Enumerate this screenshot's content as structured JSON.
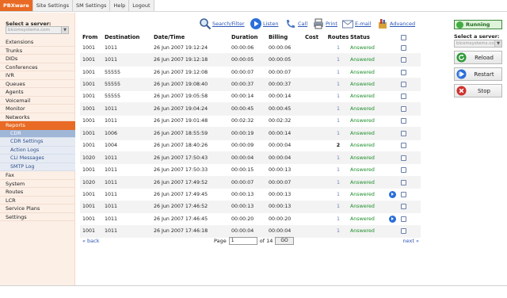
{
  "topnav": {
    "tabs": [
      "PBXware",
      "Site Settings",
      "SM Settings",
      "Help",
      "Logout"
    ]
  },
  "sidebar": {
    "select_label": "Select a server:",
    "select_value": "bicomsystems.com",
    "items": [
      "Extensions",
      "Trunks",
      "DIDs",
      "Conferences",
      "IVR",
      "Queues",
      "Agents",
      "Voicemail",
      "Monitor",
      "Networks",
      "Reports"
    ],
    "sub_items": [
      "CDR",
      "CDR Settings",
      "Action Logs",
      "CLI Messages",
      "SMTP Log"
    ],
    "items_after": [
      "Fax",
      "System",
      "Routes",
      "LCR",
      "Service Plans",
      "Settings"
    ]
  },
  "toolbar": {
    "search_filter": "Search/Filter",
    "listen": "Listen",
    "call": "Call",
    "print": "Print",
    "email": "E-mail",
    "advanced": "Advanced"
  },
  "table": {
    "headers": {
      "from": "From",
      "destination": "Destination",
      "datetime": "Date/Time",
      "duration": "Duration",
      "billing": "Billing",
      "cost": "Cost",
      "routes": "Routes",
      "status": "Status"
    },
    "rows": [
      {
        "from": "1001",
        "destination": "1011",
        "datetime": "26 Jun 2007 19:12:24",
        "duration": "00:00:06",
        "billing": "00:00:06",
        "cost": "",
        "routes": "1",
        "status": "Answered",
        "play": false
      },
      {
        "from": "1001",
        "destination": "1011",
        "datetime": "26 Jun 2007 19:12:18",
        "duration": "00:00:05",
        "billing": "00:00:05",
        "cost": "",
        "routes": "1",
        "status": "Answered",
        "play": false
      },
      {
        "from": "1001",
        "destination": "55555",
        "datetime": "26 Jun 2007 19:12:08",
        "duration": "00:00:07",
        "billing": "00:00:07",
        "cost": "",
        "routes": "1",
        "status": "Answered",
        "play": false
      },
      {
        "from": "1001",
        "destination": "55555",
        "datetime": "26 Jun 2007 19:08:40",
        "duration": "00:00:37",
        "billing": "00:00:37",
        "cost": "",
        "routes": "1",
        "status": "Answered",
        "play": false
      },
      {
        "from": "1001",
        "destination": "55555",
        "datetime": "26 Jun 2007 19:05:58",
        "duration": "00:00:14",
        "billing": "00:00:14",
        "cost": "",
        "routes": "1",
        "status": "Answered",
        "play": false
      },
      {
        "from": "1001",
        "destination": "1011",
        "datetime": "26 Jun 2007 19:04:24",
        "duration": "00:00:45",
        "billing": "00:00:45",
        "cost": "",
        "routes": "1",
        "status": "Answered",
        "play": false
      },
      {
        "from": "1001",
        "destination": "1011",
        "datetime": "26 Jun 2007 19:01:48",
        "duration": "00:02:32",
        "billing": "00:02:32",
        "cost": "",
        "routes": "1",
        "status": "Answered",
        "play": false
      },
      {
        "from": "1001",
        "destination": "1006",
        "datetime": "26 Jun 2007 18:55:59",
        "duration": "00:00:19",
        "billing": "00:00:14",
        "cost": "",
        "routes": "1",
        "status": "Answered",
        "play": false
      },
      {
        "from": "1001",
        "destination": "1004",
        "datetime": "26 Jun 2007 18:40:26",
        "duration": "00:00:09",
        "billing": "00:00:04",
        "cost": "",
        "routes": "2",
        "status": "Answered",
        "play": false
      },
      {
        "from": "1020",
        "destination": "1011",
        "datetime": "26 Jun 2007 17:50:43",
        "duration": "00:00:04",
        "billing": "00:00:04",
        "cost": "",
        "routes": "1",
        "status": "Answered",
        "play": false
      },
      {
        "from": "1001",
        "destination": "1011",
        "datetime": "26 Jun 2007 17:50:33",
        "duration": "00:00:15",
        "billing": "00:00:13",
        "cost": "",
        "routes": "1",
        "status": "Answered",
        "play": false
      },
      {
        "from": "1020",
        "destination": "1011",
        "datetime": "26 Jun 2007 17:49:52",
        "duration": "00:00:07",
        "billing": "00:00:07",
        "cost": "",
        "routes": "1",
        "status": "Answered",
        "play": false
      },
      {
        "from": "1001",
        "destination": "1011",
        "datetime": "26 Jun 2007 17:49:45",
        "duration": "00:00:13",
        "billing": "00:00:13",
        "cost": "",
        "routes": "1",
        "status": "Answered",
        "play": true
      },
      {
        "from": "1001",
        "destination": "1011",
        "datetime": "26 Jun 2007 17:46:52",
        "duration": "00:00:13",
        "billing": "00:00:13",
        "cost": "",
        "routes": "1",
        "status": "Answered",
        "play": false
      },
      {
        "from": "1001",
        "destination": "1011",
        "datetime": "26 Jun 2007 17:46:45",
        "duration": "00:00:20",
        "billing": "00:00:20",
        "cost": "",
        "routes": "1",
        "status": "Answered",
        "play": true
      },
      {
        "from": "1001",
        "destination": "1011",
        "datetime": "26 Jun 2007 17:46:18",
        "duration": "00:00:04",
        "billing": "00:00:04",
        "cost": "",
        "routes": "1",
        "status": "Answered",
        "play": false
      }
    ]
  },
  "pager": {
    "back": "« back",
    "page_label": "Page",
    "page_value": "1",
    "of_label": "of 14",
    "go": "GO",
    "next": "next »"
  },
  "right_panel": {
    "status": "Running",
    "select_label": "Select a server:",
    "select_value": "bicomsystems.com",
    "reload": "Reload",
    "restart": "Restart",
    "stop": "Stop"
  },
  "colors": {
    "accent": "#e86a24",
    "answered": "#1d8f2a",
    "link": "#2d55b5",
    "running": "#3fae3f"
  }
}
